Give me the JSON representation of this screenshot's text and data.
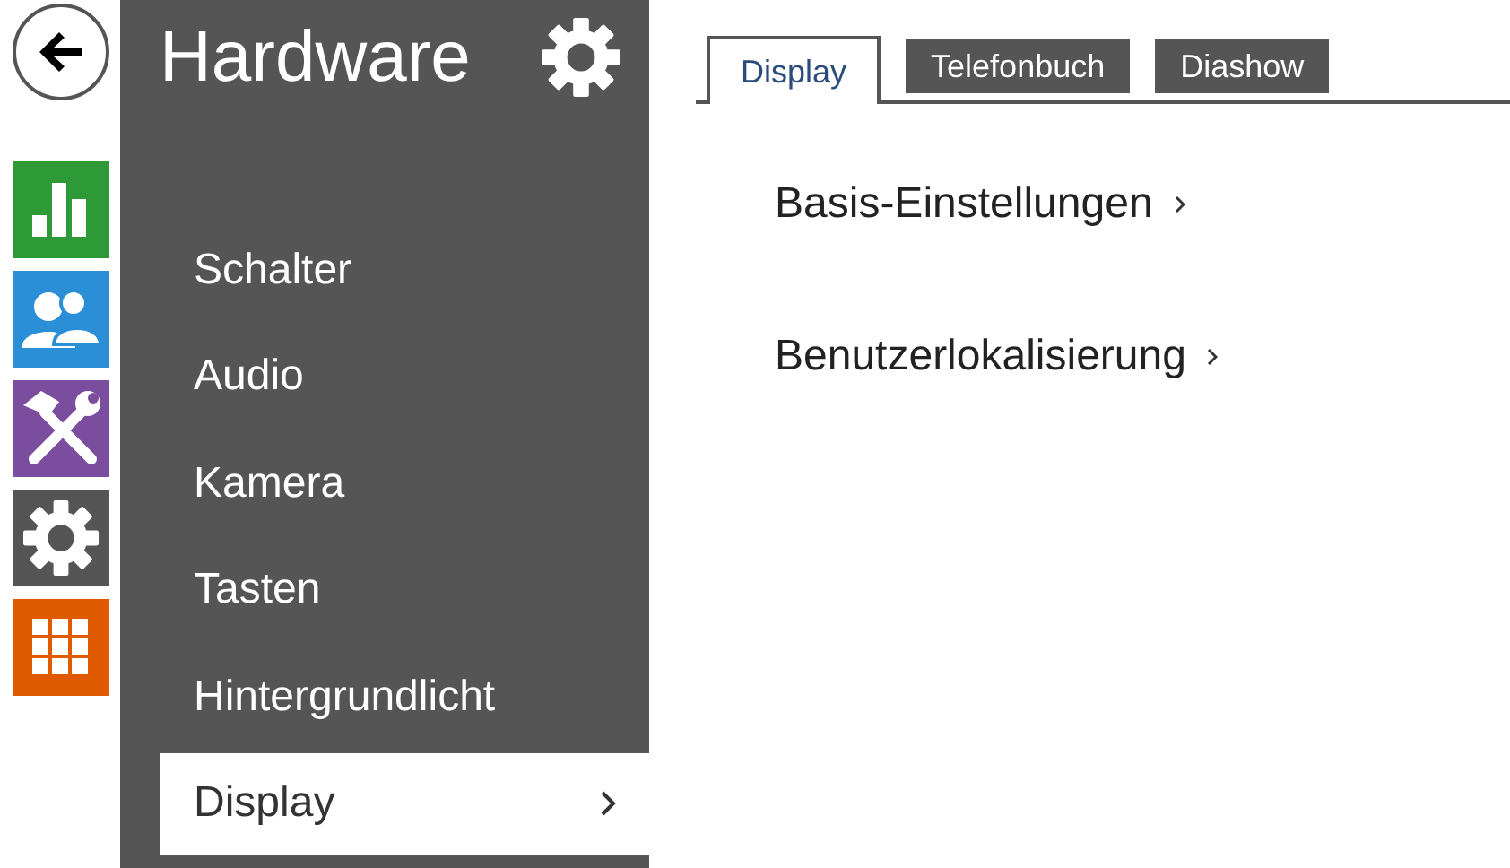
{
  "sidebar": {
    "title": "Hardware",
    "items": [
      {
        "label": "Schalter",
        "selected": false
      },
      {
        "label": "Audio",
        "selected": false
      },
      {
        "label": "Kamera",
        "selected": false
      },
      {
        "label": "Tasten",
        "selected": false
      },
      {
        "label": "Hintergrundlicht",
        "selected": false
      },
      {
        "label": "Display",
        "selected": true
      }
    ]
  },
  "tabs": [
    {
      "label": "Display",
      "selected": true
    },
    {
      "label": "Telefonbuch",
      "selected": false
    },
    {
      "label": "Diashow",
      "selected": false
    }
  ],
  "links": [
    {
      "label": "Basis-Einstellungen"
    },
    {
      "label": "Benutzerlokalisierung"
    }
  ]
}
